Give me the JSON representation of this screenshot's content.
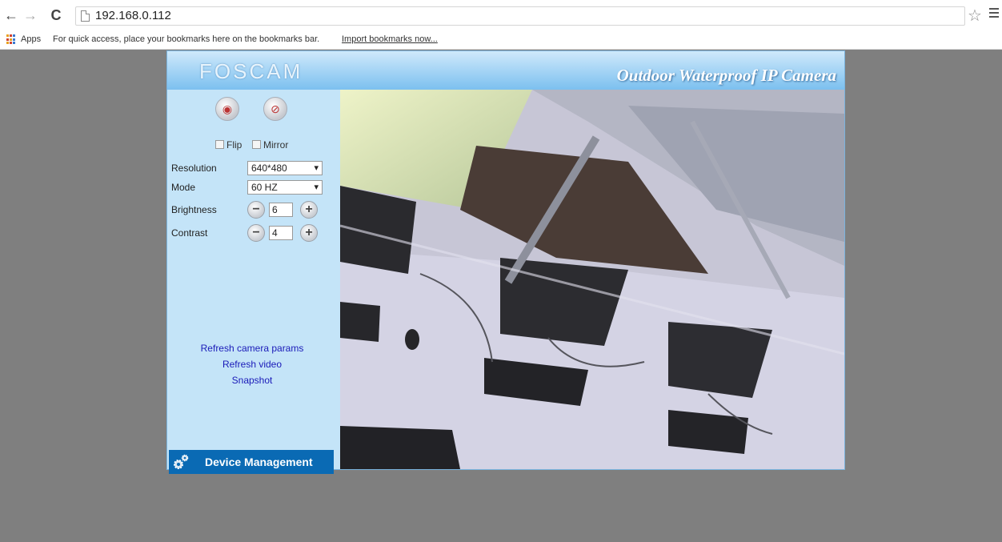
{
  "browser": {
    "url": "192.168.0.112",
    "apps_label": "Apps",
    "bookmarks_hint": "For quick access, place your bookmarks here on the bookmarks bar.",
    "import_link": "Import bookmarks now..."
  },
  "header": {
    "logo": "FOSCAM",
    "title": "Outdoor Waterproof IP Camera"
  },
  "controls": {
    "flip_label": "Flip",
    "mirror_label": "Mirror",
    "resolution_label": "Resolution",
    "resolution_value": "640*480",
    "mode_label": "Mode",
    "mode_value": "60 HZ",
    "brightness_label": "Brightness",
    "brightness_value": "6",
    "contrast_label": "Contrast",
    "contrast_value": "4"
  },
  "links": {
    "refresh_params": "Refresh camera params",
    "refresh_video": "Refresh video",
    "snapshot": "Snapshot"
  },
  "device_management": "Device Management"
}
